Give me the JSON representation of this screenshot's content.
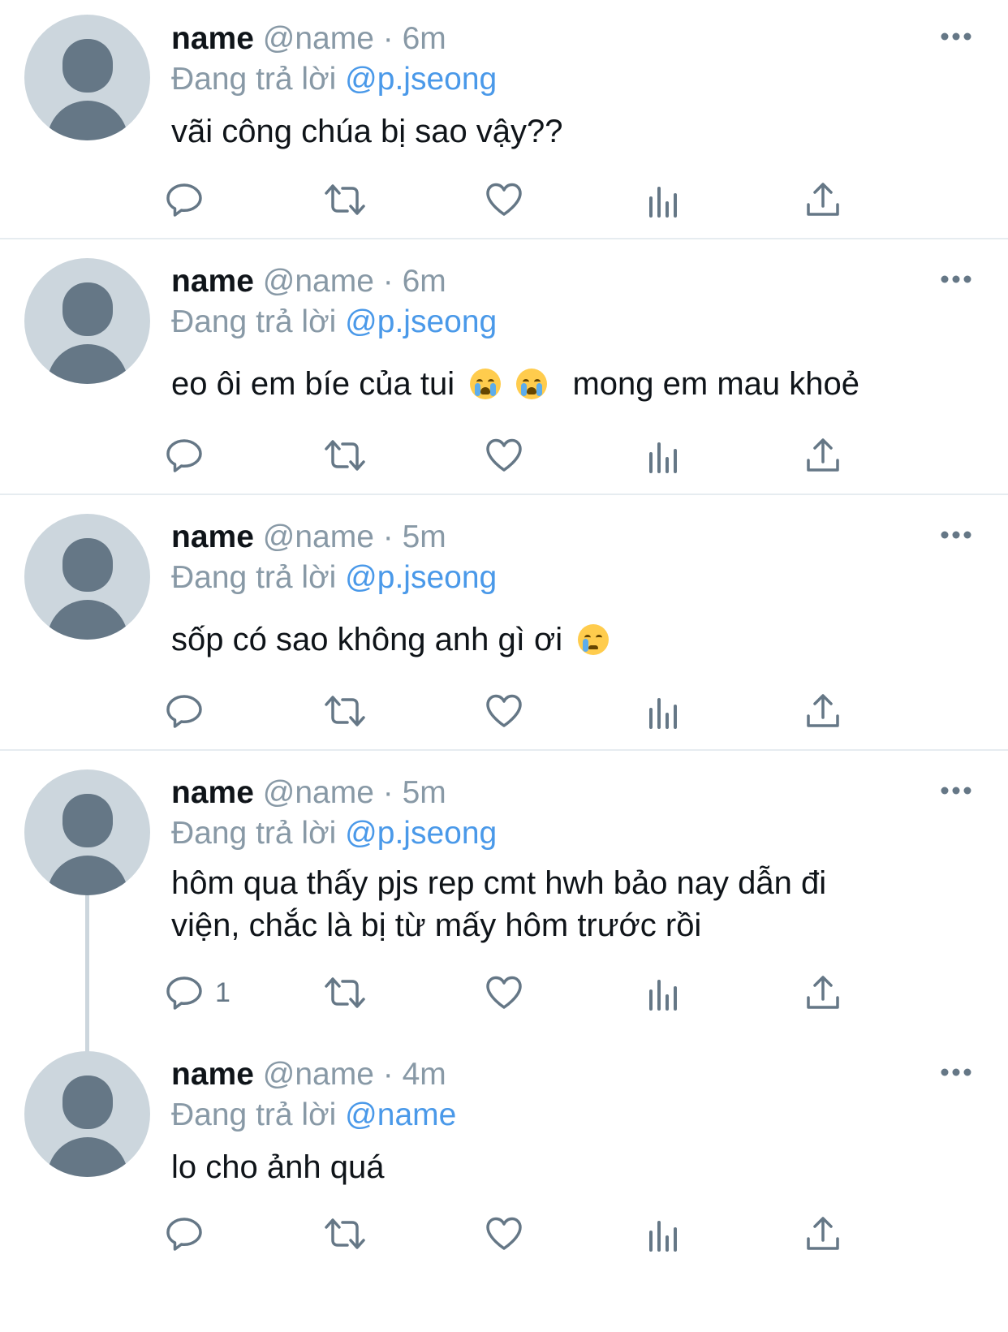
{
  "tweets": [
    {
      "name": "name",
      "handle": "@name",
      "separator": "·",
      "time": "6m",
      "replying_prefix": "Đang trả lời",
      "replying_to": "@p.jseong",
      "text": "vãi công chúa bị sao vậy??",
      "reply_count": ""
    },
    {
      "name": "name",
      "handle": "@name",
      "separator": "·",
      "time": "6m",
      "replying_prefix": "Đang trả lời",
      "replying_to": "@p.jseong",
      "text_before": "eo ôi em bíe của tui",
      "emojis": [
        "loudly-crying-face",
        "loudly-crying-face"
      ],
      "text_after": "mong em mau khoẻ",
      "reply_count": ""
    },
    {
      "name": "name",
      "handle": "@name",
      "separator": "·",
      "time": "5m",
      "replying_prefix": "Đang trả lời",
      "replying_to": "@p.jseong",
      "text_before": "sốp có sao không anh gì ơi",
      "emojis": [
        "crying-face"
      ],
      "reply_count": ""
    },
    {
      "name": "name",
      "handle": "@name",
      "separator": "·",
      "time": "5m",
      "replying_prefix": "Đang trả lời",
      "replying_to": "@p.jseong",
      "text": "hôm qua thấy pjs rep cmt hwh bảo nay dẫn đi viện, chắc là bị từ mấy hôm trước rồi",
      "reply_count": "1"
    },
    {
      "name": "name",
      "handle": "@name",
      "separator": "·",
      "time": "4m",
      "replying_prefix": "Đang trả lời",
      "replying_to": "@name",
      "text": "lo cho ảnh quá",
      "reply_count": ""
    }
  ],
  "icons": {
    "reply": "reply-icon",
    "retweet": "retweet-icon",
    "like": "heart-icon",
    "analytics": "analytics-icon",
    "share": "share-icon",
    "more": "more-icon"
  },
  "colors": {
    "mention": "#4a99e9",
    "muted": "#8899a6",
    "icon": "#657786",
    "divider": "#e6ecf0",
    "avatar_bg": "#ccd6dd",
    "avatar_fg": "#657786"
  }
}
